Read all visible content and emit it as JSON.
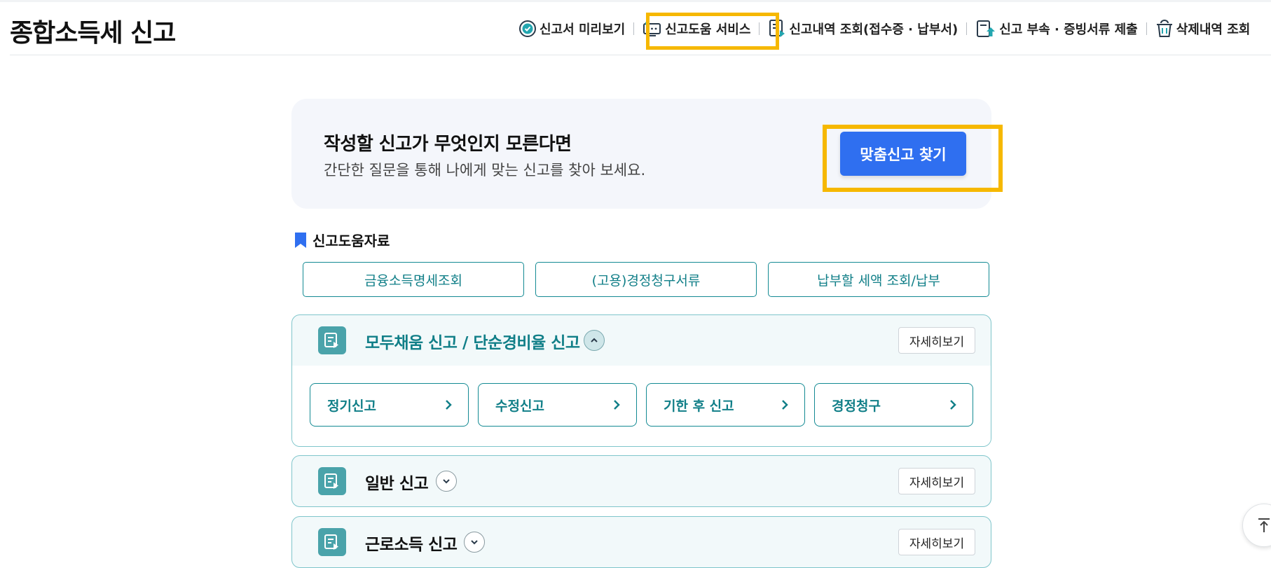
{
  "page_title": "종합소득세 신고",
  "nav": [
    {
      "label": "신고서 미리보기",
      "icon": "check-circle-icon"
    },
    {
      "label": "신고도움 서비스",
      "icon": "help-monitor-icon"
    },
    {
      "label": "신고내역 조회(접수증 · 납부서)",
      "icon": "document-list-icon"
    },
    {
      "label": "신고 부속 · 증빙서류 제출",
      "icon": "upload-document-icon"
    },
    {
      "label": "삭제내역 조회",
      "icon": "trash-icon"
    }
  ],
  "banner": {
    "title": "작성할 신고가 무엇인지 모른다면",
    "description": "간단한 질문을 통해 나에게 맞는 신고를 찾아 보세요.",
    "button_label": "맞춤신고 찾기"
  },
  "help_section": {
    "title": "신고도움자료",
    "buttons": [
      "금융소득명세조회",
      "(고용)경정청구서류",
      "납부할 세액 조회/납부"
    ]
  },
  "panels": [
    {
      "title": "모두채움 신고 / 단순경비율 신고",
      "expanded": true,
      "detail_label": "자세히보기",
      "items": [
        "정기신고",
        "수정신고",
        "기한 후 신고",
        "경정청구"
      ]
    },
    {
      "title": "일반 신고",
      "expanded": false,
      "detail_label": "자세히보기"
    },
    {
      "title": "근로소득 신고",
      "expanded": false,
      "detail_label": "자세히보기"
    }
  ],
  "colors": {
    "accent_blue": "#2f6ff0",
    "teal": "#117f88",
    "highlight": "#f6b800",
    "banner_bg": "#f4f6fb"
  }
}
